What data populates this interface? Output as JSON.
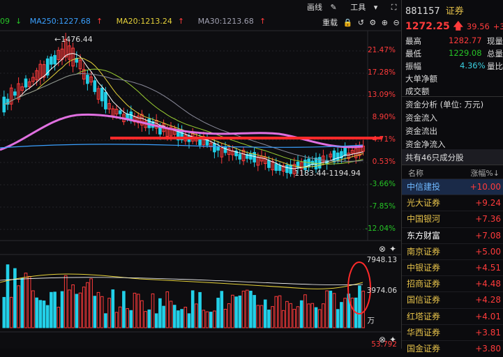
{
  "toolbar": {
    "draw_label": "画线",
    "tools_label": "工具",
    "fullscreen_icon": "expand-icon",
    "close_icon": "close-icon",
    "reset_label": "重载"
  },
  "ma": [
    {
      "label": "MA250:1227.68",
      "color": "#3aa0ff",
      "arrow": "↑"
    },
    {
      "label": "MA20:1213.24",
      "color": "#e6d23a",
      "arrow": "↑"
    },
    {
      "label": "MA30:1213.68",
      "color": "#a0a0b0",
      "arrow": "↑"
    }
  ],
  "ma_prefix": "09",
  "annotations": {
    "high": "←1476.44",
    "range": "1183.44-1194.94"
  },
  "pct_labels": [
    {
      "t": "21.47%",
      "c": "red"
    },
    {
      "t": "17.28%",
      "c": "red"
    },
    {
      "t": "13.09%",
      "c": "red"
    },
    {
      "t": "8.90%",
      "c": "red"
    },
    {
      "t": "4.71%",
      "c": "red"
    },
    {
      "t": "0.53%",
      "c": "red"
    },
    {
      "t": "-3.66%",
      "c": "green"
    },
    {
      "t": "-7.85%",
      "c": "green"
    },
    {
      "t": "-12.04%",
      "c": "green"
    }
  ],
  "volume_labels": {
    "top": "7948.13",
    "mid": "3974.06",
    "unit": "万",
    "bottom": "53.792"
  },
  "panel": {
    "code": "881157",
    "name": "证券",
    "price": "1272.25",
    "change": "39.56",
    "change_pct": "+3.",
    "high_label": "最高",
    "high_val": "1282.77",
    "high_extra": "现量",
    "low_label": "最低",
    "low_val": "1229.08",
    "low_extra": "总量",
    "amp_label": "振幅",
    "amp_val": "4.36%",
    "amp_extra": "量比",
    "bignet_label": "大单净额",
    "turnover_label": "成交额",
    "fund_title": "资金分析 (单位: 万元)",
    "fund_in": "资金流入",
    "fund_out": "资金流出",
    "fund_net": "资金净流入",
    "constituents": "共有46只成分股",
    "col_name": "名称",
    "col_pct": "涨幅%",
    "stocks": [
      {
        "name": "中信建投",
        "pct": "+10.00"
      },
      {
        "name": "光大证券",
        "pct": "+9.24"
      },
      {
        "name": "中国银河",
        "pct": "+7.36"
      },
      {
        "name": "东方财富",
        "pct": "+7.08"
      },
      {
        "name": "南京证券",
        "pct": "+5.00"
      },
      {
        "name": "中银证券",
        "pct": "+4.51"
      },
      {
        "name": "招商证券",
        "pct": "+4.48"
      },
      {
        "name": "国信证券",
        "pct": "+4.28"
      },
      {
        "name": "红塔证券",
        "pct": "+4.01"
      },
      {
        "name": "华西证券",
        "pct": "+3.81"
      },
      {
        "name": "国金证券",
        "pct": "+3.80"
      }
    ]
  }
}
